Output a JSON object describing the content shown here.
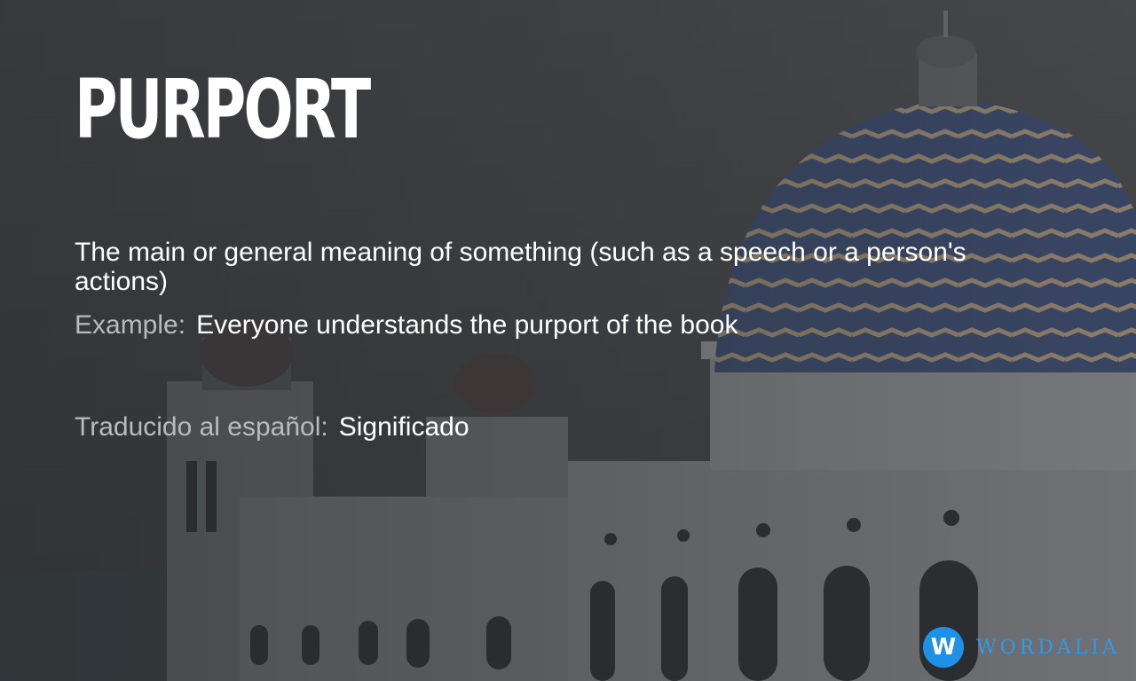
{
  "word": "PURPORT",
  "definition": "The main or general meaning of something (such as a speech or a person's actions)",
  "example": {
    "label": "Example:",
    "text": "Everyone understands the purport of the book"
  },
  "translation": {
    "label": "Traducido al español:",
    "text": "Significado"
  },
  "brand": {
    "logo_letter": "W",
    "name": "WORDALIA",
    "color": "#1e90e8"
  }
}
